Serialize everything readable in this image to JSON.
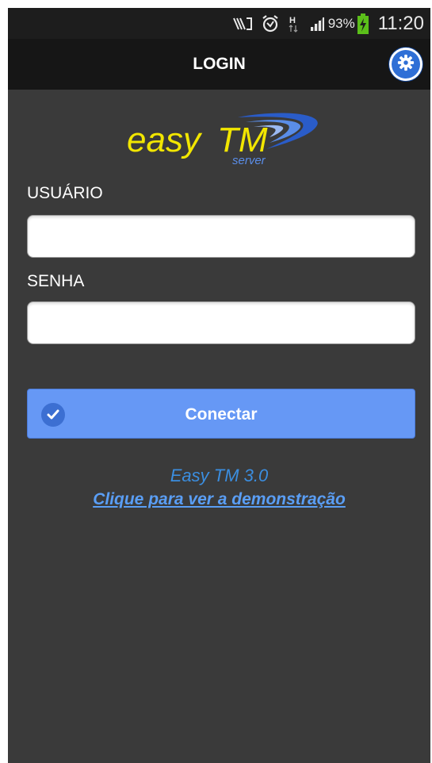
{
  "status_bar": {
    "battery_percent": "93%",
    "time": "11:20",
    "icons": [
      "nfc-icon",
      "alarm-icon",
      "hspa-data-icon",
      "signal-icon",
      "battery-charging-icon"
    ]
  },
  "action_bar": {
    "title": "LOGIN",
    "settings_icon": "gear-icon"
  },
  "logo": {
    "brand": "easyTM",
    "sub": "server"
  },
  "form": {
    "username_label": "USUÁRIO",
    "username_value": "",
    "password_label": "SENHA",
    "password_value": ""
  },
  "connect_button": {
    "label": "Conectar",
    "icon": "checkmark-icon"
  },
  "footer": {
    "version": "Easy TM 3.0",
    "demo_link": "Clique para ver a demonstração"
  },
  "colors": {
    "background": "#3a3a3a",
    "action_bar": "#161616",
    "button": "#6698f5",
    "link": "#5a9ef5",
    "logo_yellow": "#f2e600",
    "logo_blue": "#2a5cc8"
  }
}
